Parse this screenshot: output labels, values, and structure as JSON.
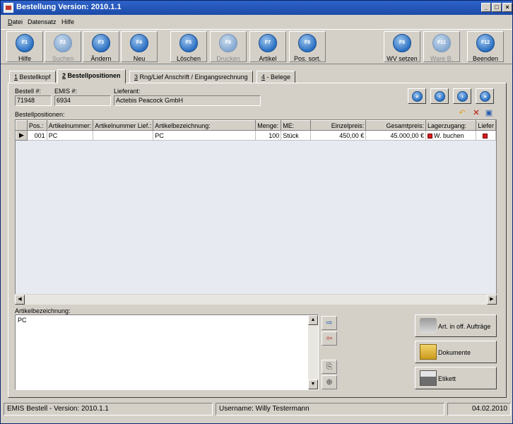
{
  "window": {
    "title": "Bestellung Version: 2010.1.1",
    "min": "_",
    "max": "□",
    "close": "×"
  },
  "menu": [
    {
      "key": "D",
      "rest": "atei"
    },
    {
      "key": "",
      "rest": "Datensatz"
    },
    {
      "key": "",
      "rest": "Hilfe"
    }
  ],
  "toolbar": [
    {
      "key": "F1",
      "label": "Hilfe",
      "state": "enabled"
    },
    {
      "key": "F2",
      "label": "Suchen",
      "state": "disabled"
    },
    {
      "key": "F3",
      "label": "Ändern",
      "state": "enabled"
    },
    {
      "key": "F4",
      "label": "Neu",
      "state": "enabled"
    },
    {
      "key": "F5",
      "label": "Löschen",
      "state": "enabled"
    },
    {
      "key": "F6",
      "label": "Drucken",
      "state": "disabled"
    },
    {
      "key": "F7",
      "label": "Artikel",
      "state": "enabled"
    },
    {
      "key": "F8",
      "label": "Pos. sort.",
      "state": "enabled"
    },
    {
      "key": "F9",
      "label": "WV setzen",
      "state": "enabled"
    },
    {
      "key": "F11",
      "label": "Ware B.",
      "state": "disabled"
    },
    {
      "key": "F12",
      "label": "Beenden",
      "state": "enabled"
    }
  ],
  "tabs": [
    {
      "num": "1",
      "label": " Bestellkopf",
      "active": false
    },
    {
      "num": "2",
      "label": " Bestellpositionen",
      "active": true
    },
    {
      "num": "3",
      "label": " Rng/Lief Anschrift / Eingangsrechnung",
      "active": false
    },
    {
      "num": "4",
      "label": " - Belege",
      "active": false
    }
  ],
  "header": {
    "bestell_label": "Bestell #:",
    "bestell_value": "71948",
    "emis_label": "EMIS #:",
    "emis_value": "6934",
    "lieferant_label": "Lieferant:",
    "lieferant_value": "Actebis Peacock GmbH",
    "positions_label": "Bestellpositionen:"
  },
  "grid": {
    "columns": [
      "Pos.:",
      "Artikelnummer:",
      "Artikelnummer Lief.:",
      "Artikelbezeichnung:",
      "Menge:",
      "ME:",
      "Einzelpreis:",
      "Gesamtpreis:",
      "Lagerzugang:",
      "Liefer"
    ],
    "rows": [
      {
        "pos": "001",
        "artnr": "PC",
        "artnr_lief": "",
        "bez": "PC",
        "menge": "100",
        "me": "Stück",
        "einzel": "450,00 €",
        "gesamt": "45.000,00 €",
        "lager": "W. buchen"
      }
    ]
  },
  "article": {
    "label": "Artikelbezeichnung:",
    "text": "PC"
  },
  "buttons": {
    "auftraege": "Art. in off. Aufträge",
    "dokumente": "Dokumente",
    "etikett": "Etikett"
  },
  "status": {
    "left": "EMIS Bestell - Version: 2010.1.1",
    "mid": "Username: Willy Testermann",
    "right": "04.02.2010"
  },
  "colors": {
    "title_bar": "#1c4ba8",
    "key_button": "#2a6fc2",
    "grid_bg": "#e7eaf1",
    "status_dot": "#d21e1e"
  }
}
